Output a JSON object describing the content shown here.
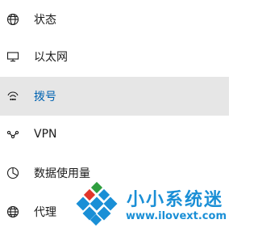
{
  "nav": {
    "items": [
      {
        "label": "状态",
        "icon": "globe-status-icon"
      },
      {
        "label": "以太网",
        "icon": "ethernet-monitor-icon"
      },
      {
        "label": "拨号",
        "icon": "dialup-icon",
        "selected": true
      },
      {
        "label": "VPN",
        "icon": "vpn-icon"
      },
      {
        "label": "数据使用量",
        "icon": "data-usage-pie-icon"
      },
      {
        "label": "代理",
        "icon": "globe-proxy-icon"
      }
    ]
  },
  "watermark": {
    "text_cn": "小小系统迷",
    "url": "www.ilovext.com",
    "color": "#1a8fd6"
  },
  "colors": {
    "selected_bg": "#e6e6e6",
    "selected_text": "#0063b1",
    "text": "#1b1b1b"
  }
}
